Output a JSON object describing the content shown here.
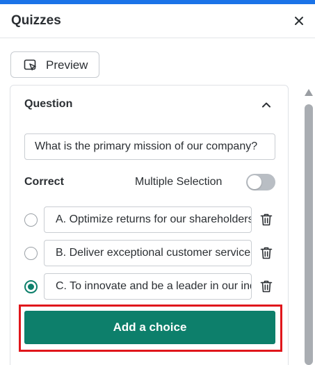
{
  "panel": {
    "title": "Quizzes",
    "accent_color": "#1a73e8"
  },
  "toolbar": {
    "preview_label": "Preview"
  },
  "question": {
    "heading": "Question",
    "text": "What is the primary mission of our company?",
    "correct_label": "Correct",
    "multiple_selection_label": "Multiple Selection",
    "multiple_selection_enabled": false
  },
  "choices": [
    {
      "text": "A. Optimize returns for our shareholders",
      "selected": false
    },
    {
      "text": "B. Deliver exceptional customer service",
      "selected": false
    },
    {
      "text": "C. To innovate and be a leader in our industry",
      "selected": true
    }
  ],
  "actions": {
    "add_choice_label": "Add a choice",
    "primary_color": "#0d7f6b",
    "highlight_color": "#e0161b"
  }
}
